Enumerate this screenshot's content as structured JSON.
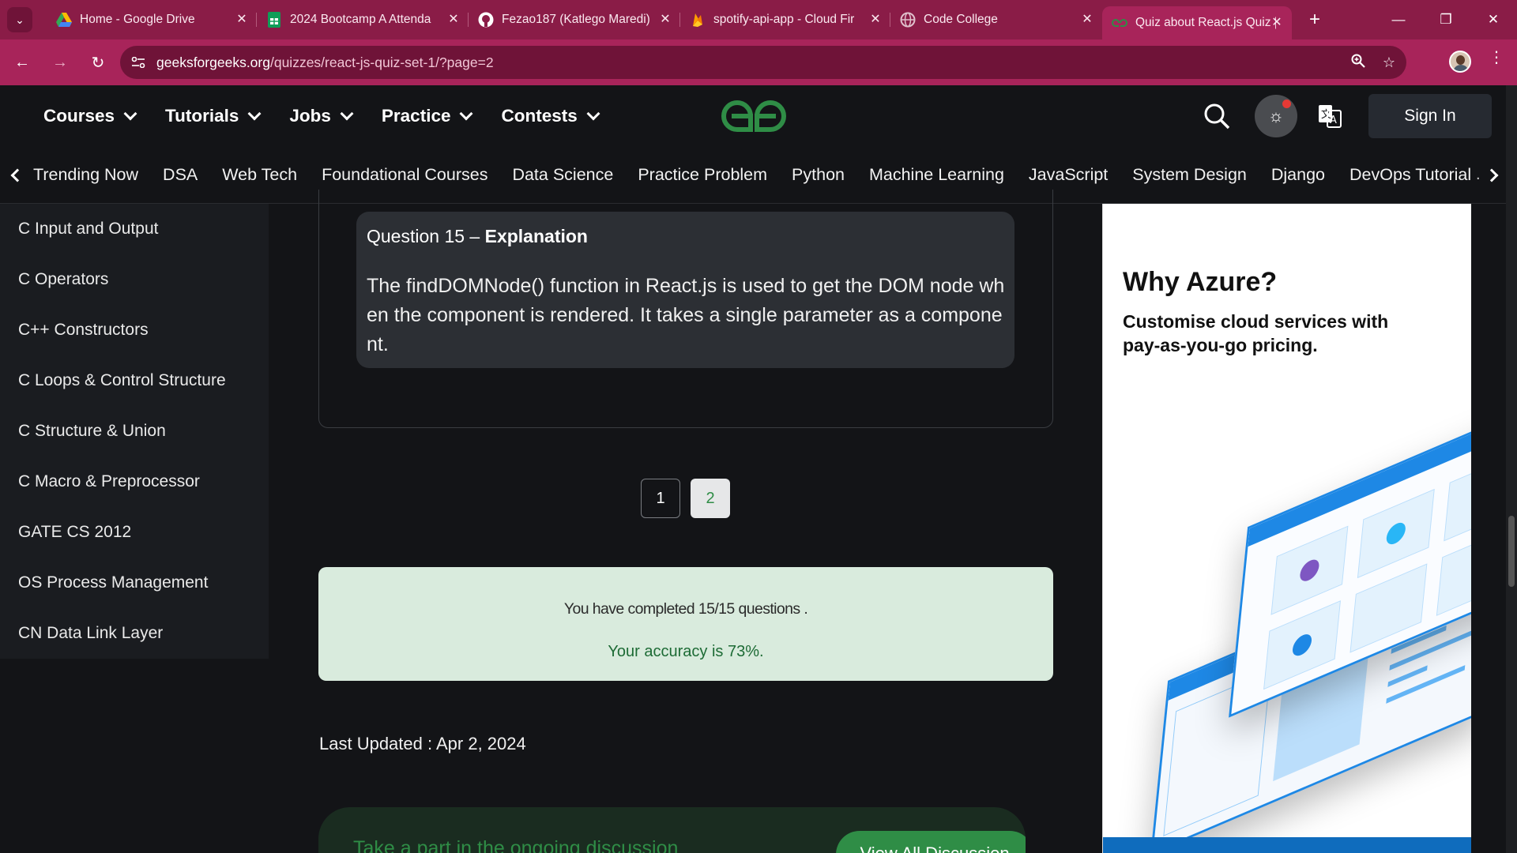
{
  "browser": {
    "tabs": [
      {
        "title": "Home - Google Drive",
        "icon": "google-drive-icon"
      },
      {
        "title": "2024 Bootcamp A Attenda",
        "icon": "google-sheets-icon"
      },
      {
        "title": "Fezao187 (Katlego Maredi)",
        "icon": "github-icon"
      },
      {
        "title": "spotify-api-app - Cloud Fir",
        "icon": "firebase-icon"
      },
      {
        "title": "Code College",
        "icon": "globe-icon"
      },
      {
        "title": "Quiz about React.js Quiz | G",
        "icon": "gfg-icon"
      }
    ],
    "url_domain": "geeksforgeeks.org",
    "url_path": "/quizzes/react-js-quiz-set-1/?page=2",
    "colors": {
      "chrome": "#a8245a",
      "tabstrip": "#8a1c47"
    }
  },
  "header": {
    "menu": [
      "Courses",
      "Tutorials",
      "Jobs",
      "Practice",
      "Contests"
    ],
    "sign_in": "Sign In",
    "subnav": [
      "Trending Now",
      "DSA",
      "Web Tech",
      "Foundational Courses",
      "Data Science",
      "Practice Problem",
      "Python",
      "Machine Learning",
      "JavaScript",
      "System Design",
      "Django",
      "DevOps Tutorial"
    ]
  },
  "sidebar": {
    "items": [
      "C Input and Output",
      "C Operators",
      "C++ Constructors",
      "C Loops & Control Structure",
      "C Structure & Union",
      "C Macro & Preprocessor",
      "GATE CS 2012",
      "OS Process Management",
      "CN Data Link Layer"
    ]
  },
  "main": {
    "explanation": {
      "prefix": "Question 15 – ",
      "heading": "Explanation",
      "body": "The findDOMNode() function in React.js is used to get the DOM node when the component is rendered. It takes a single parameter as a component."
    },
    "pagination": {
      "pages": [
        "1",
        "2"
      ],
      "current": "2"
    },
    "result": {
      "completed": "You have completed 15/15 questions .",
      "accuracy": "Your accuracy is 73%."
    },
    "last_updated": "Last Updated : Apr 2, 2024",
    "discussion": {
      "text": "Take a part in the ongoing discussion",
      "button": "View All Discussion"
    }
  },
  "ad": {
    "heading": "Why Azure?",
    "subheading": "Customise cloud services with pay-as-you-go pricing."
  }
}
